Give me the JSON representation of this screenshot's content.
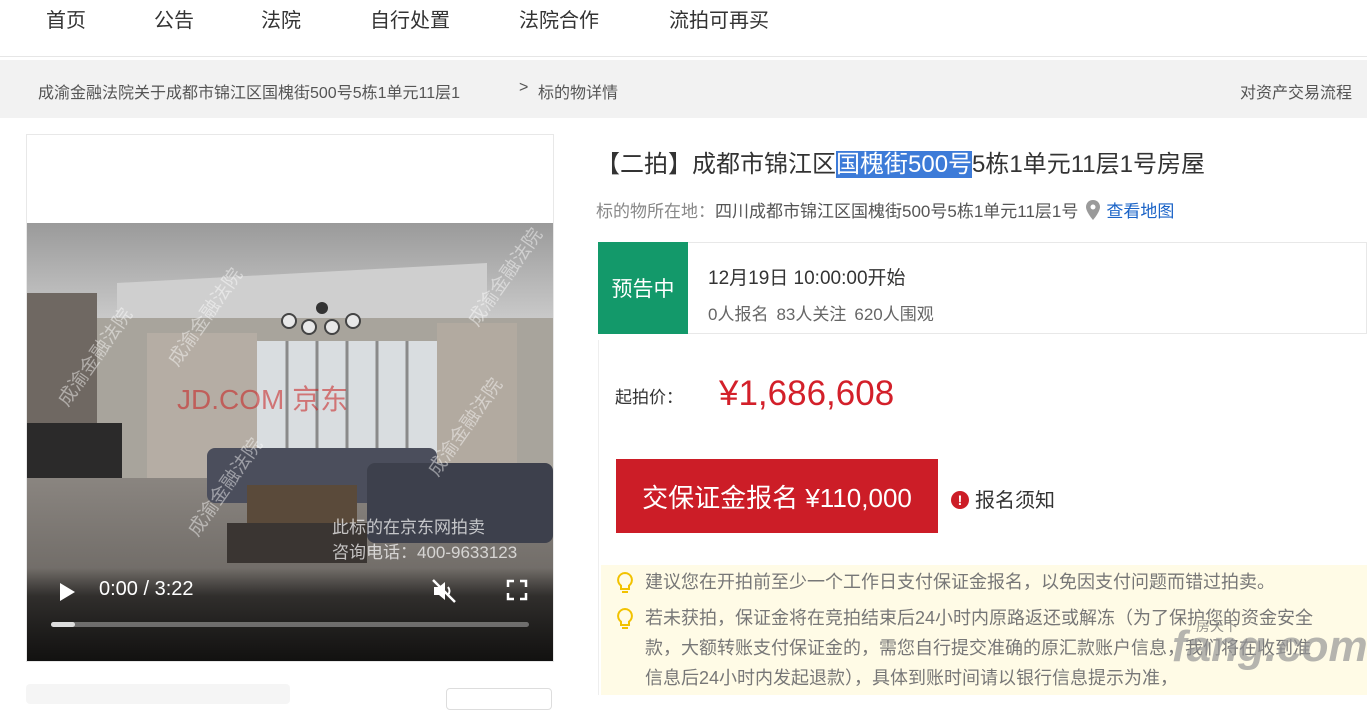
{
  "nav": {
    "items": [
      "首页",
      "公告",
      "法院",
      "自行处置",
      "法院合作",
      "流拍可再买"
    ]
  },
  "breadcrumb": {
    "item1": "成渝金融法院关于成都市锦江区国槐街500号5栋1单元11层1",
    "separator": ">",
    "item2": "标的物详情",
    "right_link": "对资产交易流程"
  },
  "video": {
    "time": "0:00 / 3:22",
    "progress": 0.05,
    "watermark_court": "成渝金融法院",
    "watermark_brand": "JD.COM 京东",
    "overlay_line1": "此标的在京东网拍卖",
    "overlay_line2": "咨询电话：400-9633123"
  },
  "lot": {
    "title_prefix": "【二拍】成都市锦江区",
    "title_highlight": "国槐街500号",
    "title_suffix": "5栋1单元11层1号房屋",
    "location_label": "标的物所在地：",
    "location_value": "四川成都市锦江区国槐街500号5栋1单元11层1号",
    "map_link": "查看地图"
  },
  "status": {
    "badge": "预告中",
    "start_time": "12月19日 10:00:00开始",
    "signups": "0人报名",
    "followers": "83人关注",
    "watchers": "620人围观"
  },
  "price": {
    "label": "起拍价：",
    "value": "¥1,686,608",
    "deposit_button": "交保证金报名 ¥110,000",
    "notice_link": "报名须知"
  },
  "tips": {
    "tip1": "建议您在开拍前至少一个工作日支付保证金报名，以免因支付问题而错过拍卖。",
    "tip2_line1": "若未获拍，保证金将在竞拍结束后24小时内原路返还或解冻（为了保护您的资金安全",
    "tip2_line2": "款，大额转账支付保证金的，需您自行提交准确的原汇款账户信息，我们将在收到准",
    "tip2_line3": "信息后24小时内发起退款），具体到账时间请以银行信息提示为准，"
  },
  "watermark": {
    "site": "fang.com",
    "site_cn": "房天下"
  },
  "colors": {
    "accent_red": "#cc1d27",
    "status_green": "#13996a",
    "link_blue": "#1a63c7",
    "highlight_blue": "#3d7bd8",
    "tip_bg": "#fffbe6"
  }
}
